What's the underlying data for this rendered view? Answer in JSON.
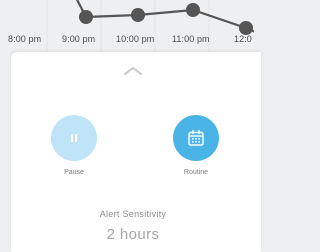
{
  "timeline": {
    "times": [
      "8:00 pm",
      "9:00 pm",
      "10:00 pm",
      "11:00 pm",
      "12:0"
    ]
  },
  "panel": {
    "actions": [
      {
        "label": "Pause",
        "icon": "pause-icon"
      },
      {
        "label": "Routine",
        "icon": "calendar-icon"
      }
    ],
    "alert_sensitivity": {
      "label": "Alert Sensitivity",
      "value": "2 hours"
    }
  },
  "colors": {
    "pause_button": "#bfe3f7",
    "routine_button": "#4bb4e6",
    "timeline_line": "#555555"
  }
}
